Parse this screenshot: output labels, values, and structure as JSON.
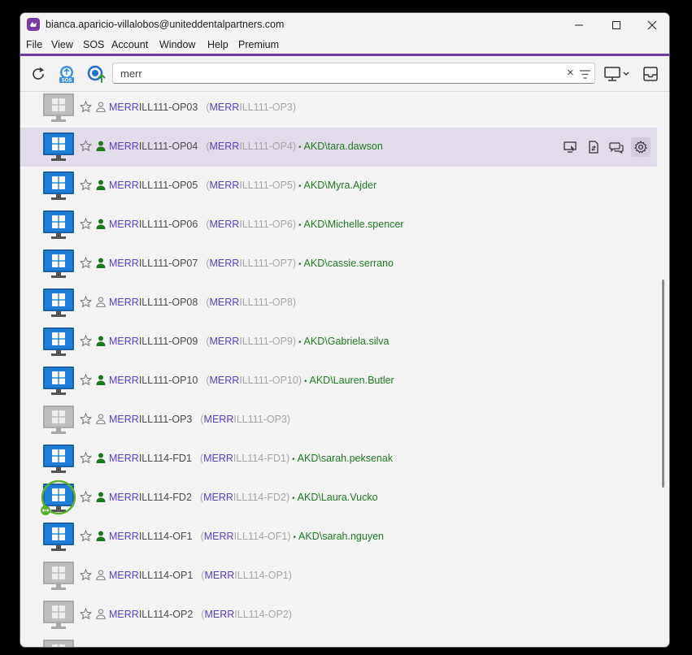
{
  "window": {
    "title": "bianca.aparicio-villalobos@uniteddentalpartners.com",
    "controls": [
      "minimize",
      "maximize",
      "close"
    ]
  },
  "menu": [
    "File",
    "View",
    "SOS",
    "Account",
    "Window",
    "Help",
    "Premium"
  ],
  "toolbar": {
    "sos_label": "SOS",
    "search": {
      "value": "merr",
      "placeholder": ""
    }
  },
  "colors": {
    "accent": "#6b3a9c",
    "match_text": "#5b3fc4",
    "user_text": "#1f7a1f",
    "online_monitor": "#1e7fd6",
    "offline_monitor": "#bdbdbd",
    "selected_row": "#e2dcea",
    "connected_ring": "#5cb030"
  },
  "rows": [
    {
      "match": "MERR",
      "rest": "ILL111-OP03",
      "alias_rest": "ILL111-OP3)",
      "user": "",
      "online": false,
      "selected": false,
      "connected": false
    },
    {
      "match": "MERR",
      "rest": "ILL111-OP04",
      "alias_rest": "ILL111-OP4)",
      "user": "AKD\\tara.dawson",
      "online": true,
      "selected": true,
      "connected": false
    },
    {
      "match": "MERR",
      "rest": "ILL111-OP05",
      "alias_rest": "ILL111-OP5)",
      "user": "AKD\\Myra.Ajder",
      "online": true,
      "selected": false,
      "connected": false
    },
    {
      "match": "MERR",
      "rest": "ILL111-OP06",
      "alias_rest": "ILL111-OP6)",
      "user": "AKD\\Michelle.spencer",
      "online": true,
      "selected": false,
      "connected": false
    },
    {
      "match": "MERR",
      "rest": "ILL111-OP07",
      "alias_rest": "ILL111-OP7)",
      "user": "AKD\\cassie.serrano",
      "online": true,
      "selected": false,
      "connected": false
    },
    {
      "match": "MERR",
      "rest": "ILL111-OP08",
      "alias_rest": "ILL111-OP8)",
      "user": "",
      "online": true,
      "selected": false,
      "connected": false
    },
    {
      "match": "MERR",
      "rest": "ILL111-OP09",
      "alias_rest": "ILL111-OP9)",
      "user": "AKD\\Gabriela.silva",
      "online": true,
      "selected": false,
      "connected": false
    },
    {
      "match": "MERR",
      "rest": "ILL111-OP10",
      "alias_rest": "ILL111-OP10)",
      "user": "AKD\\Lauren.Butler",
      "online": true,
      "selected": false,
      "connected": false
    },
    {
      "match": "MERR",
      "rest": "ILL111-OP3",
      "alias_rest": "ILL111-OP3)",
      "user": "",
      "online": false,
      "selected": false,
      "connected": false
    },
    {
      "match": "MERR",
      "rest": "ILL114-FD1",
      "alias_rest": "ILL114-FD1)",
      "user": "AKD\\sarah.peksenak",
      "online": true,
      "selected": false,
      "connected": false
    },
    {
      "match": "MERR",
      "rest": "ILL114-FD2",
      "alias_rest": "ILL114-FD2)",
      "user": "AKD\\Laura.Vucko",
      "online": true,
      "selected": false,
      "connected": true
    },
    {
      "match": "MERR",
      "rest": "ILL114-OF1",
      "alias_rest": "ILL114-OF1)",
      "user": "AKD\\sarah.nguyen",
      "online": true,
      "selected": false,
      "connected": false
    },
    {
      "match": "MERR",
      "rest": "ILL114-OP1",
      "alias_rest": "ILL114-OP1)",
      "user": "",
      "online": false,
      "selected": false,
      "connected": false
    },
    {
      "match": "MERR",
      "rest": "ILL114-OP2",
      "alias_rest": "ILL114-OP2)",
      "user": "",
      "online": false,
      "selected": false,
      "connected": false
    },
    {
      "match": "",
      "rest": "",
      "alias_rest": "",
      "user": "",
      "online": false,
      "selected": false,
      "connected": false
    }
  ],
  "row_actions": [
    "remote-control-icon",
    "file-transfer-icon",
    "chat-icon",
    "settings-icon"
  ],
  "alias_open": "(",
  "separator": "•"
}
